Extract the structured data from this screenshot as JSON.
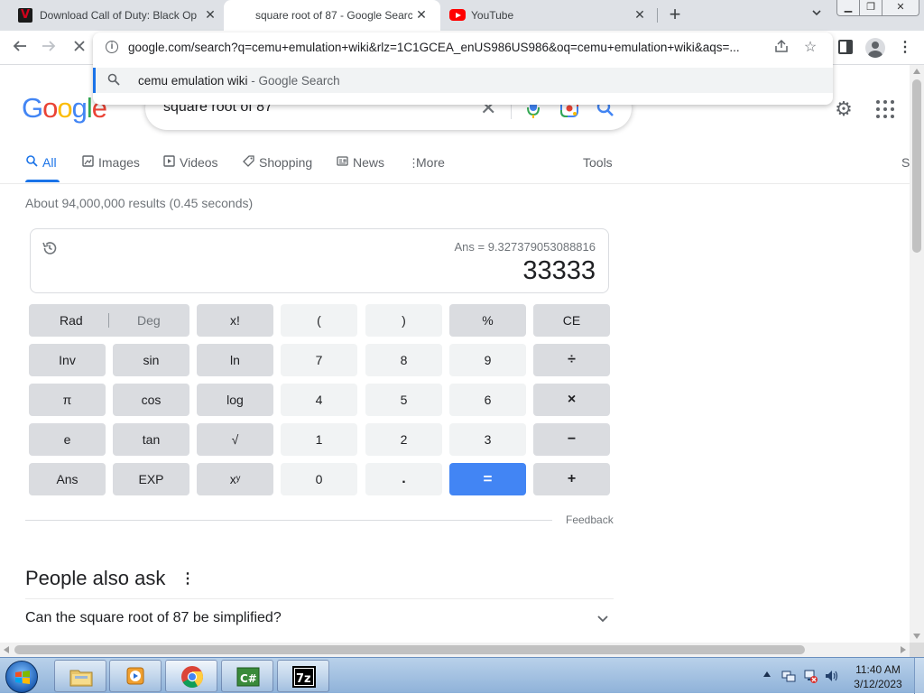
{
  "browser": {
    "tabs": [
      {
        "title": "Download Call of Duty: Black Op",
        "favicon": "v-logo-icon",
        "active": false
      },
      {
        "title": "square root of 87 - Google Searc",
        "favicon": "google-icon",
        "active": true
      },
      {
        "title": "YouTube",
        "favicon": "youtube-icon",
        "active": false
      }
    ],
    "new_tab_label": "+",
    "address_bar": {
      "url": "google.com/search?q=cemu+emulation+wiki&rlz=1C1GCEA_enUS986US986&oq=cemu+emulation+wiki&aqs=...",
      "suggestion": "cemu emulation wiki",
      "suggestion_suffix": " - Google Search"
    },
    "icons": {
      "back": "arrow-left-icon",
      "forward": "arrow-right-icon",
      "reload": "stop-loading-icon",
      "share": "share-icon",
      "bookmark": "star-icon",
      "side_panel": "side-panel-icon",
      "profile": "profile-icon",
      "menu": "kebab-menu-icon"
    }
  },
  "google": {
    "logo": {
      "letters": [
        "G",
        "o",
        "o",
        "g",
        "l",
        "e"
      ],
      "colors": [
        "#4285f4",
        "#ea4335",
        "#fbbc05",
        "#4285f4",
        "#34a853",
        "#ea4335"
      ]
    },
    "query": "square root of 87",
    "filters": [
      {
        "label": "All",
        "icon": "search-icon",
        "active": true
      },
      {
        "label": "Images",
        "icon": "image-icon",
        "active": false
      },
      {
        "label": "Videos",
        "icon": "play-icon",
        "active": false
      },
      {
        "label": "Shopping",
        "icon": "tag-icon",
        "active": false
      },
      {
        "label": "News",
        "icon": "news-icon",
        "active": false
      },
      {
        "label": "More",
        "icon": "kebab-icon",
        "active": false
      }
    ],
    "tools_label": "Tools",
    "partial_label": "S",
    "result_stats": "About 94,000,000 results (0.45 seconds)",
    "accent_color": "#1a73e8"
  },
  "calculator": {
    "ans_line": "Ans = 9.327379053088816",
    "display_value": "33333",
    "rad_label": "Rad",
    "deg_label": "Deg",
    "keys": [
      [
        "x!",
        "(",
        ")",
        "%",
        "CE"
      ],
      [
        "Inv",
        "sin",
        "ln",
        "7",
        "8",
        "9",
        "÷"
      ],
      [
        "π",
        "cos",
        "log",
        "4",
        "5",
        "6",
        "×"
      ],
      [
        "e",
        "tan",
        "√",
        "1",
        "2",
        "3",
        "−"
      ],
      [
        "Ans",
        "EXP",
        "xʸ",
        "0",
        ".",
        "=",
        "+"
      ]
    ],
    "equals_color": "#4285f4",
    "feedback_label": "Feedback"
  },
  "people_also_ask": {
    "title": "People also ask",
    "questions": [
      "Can the square root of 87 be simplified?"
    ]
  },
  "taskbar": {
    "apps": [
      {
        "name": "windows-explorer",
        "icon": "folder-icon"
      },
      {
        "name": "media-player",
        "icon": "media-player-icon"
      },
      {
        "name": "chrome",
        "icon": "chrome-icon",
        "active": true
      },
      {
        "name": "csharp",
        "icon": "csharp-icon"
      },
      {
        "name": "7zip",
        "icon": "7zip-icon"
      }
    ],
    "clock_time": "11:40 AM",
    "clock_date": "3/12/2023"
  }
}
